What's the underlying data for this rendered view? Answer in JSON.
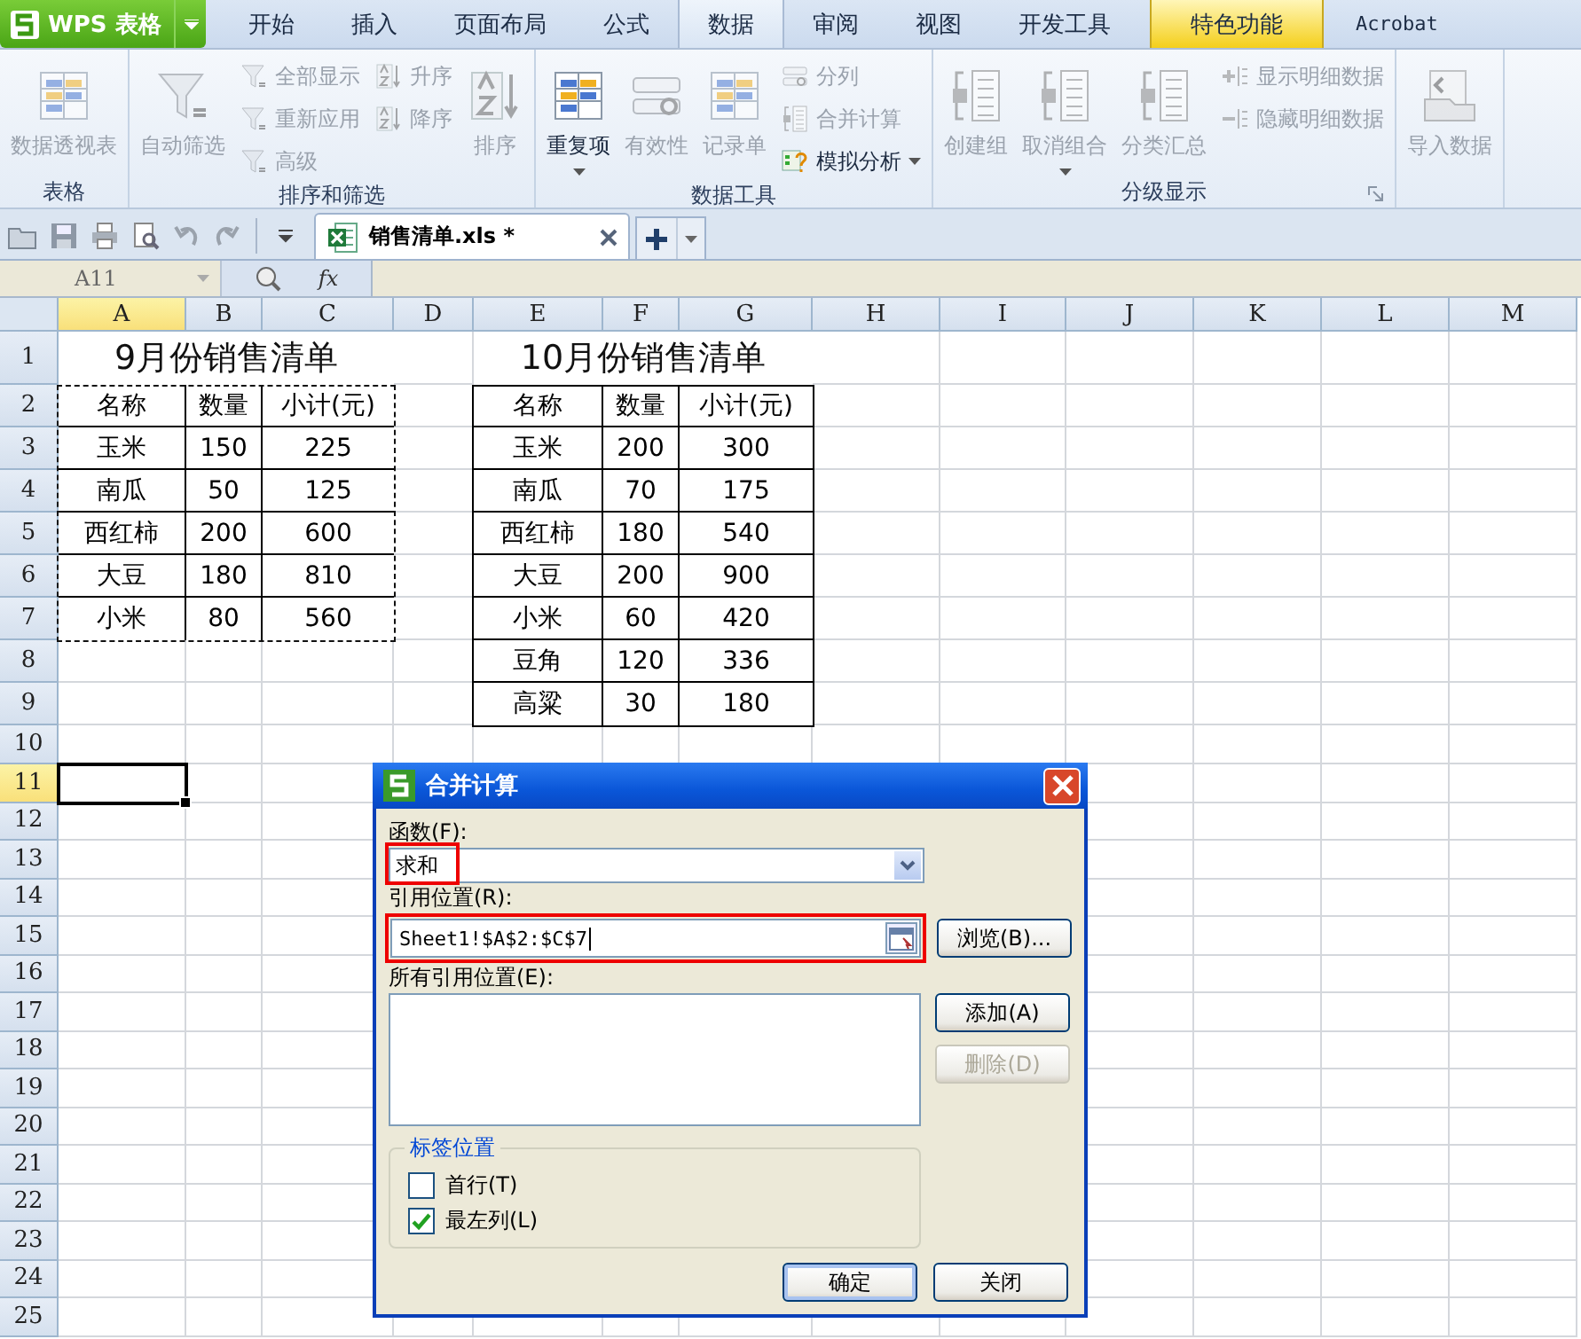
{
  "app_button": {
    "label": "WPS 表格"
  },
  "ribbon_tabs": [
    {
      "label": "开始",
      "selected": false,
      "kind": "normal"
    },
    {
      "label": "插入",
      "selected": false,
      "kind": "normal"
    },
    {
      "label": "页面布局",
      "selected": false,
      "kind": "normal"
    },
    {
      "label": "公式",
      "selected": false,
      "kind": "normal"
    },
    {
      "label": "数据",
      "selected": true,
      "kind": "normal"
    },
    {
      "label": "审阅",
      "selected": false,
      "kind": "normal"
    },
    {
      "label": "视图",
      "selected": false,
      "kind": "normal"
    },
    {
      "label": "开发工具",
      "selected": false,
      "kind": "normal"
    },
    {
      "label": "特色功能",
      "selected": false,
      "kind": "special"
    },
    {
      "label": "Acrobat",
      "selected": false,
      "kind": "addin"
    }
  ],
  "ribbon_groups": [
    {
      "label": "表格",
      "items": [
        {
          "kind": "large",
          "label": "数据透视表",
          "disabled": true
        }
      ]
    },
    {
      "label": "排序和筛选",
      "items": [
        {
          "kind": "large",
          "label": "自动筛选",
          "disabled": true
        },
        {
          "kind": "small",
          "label": "全部显示",
          "disabled": true
        },
        {
          "kind": "small",
          "label": "重新应用",
          "disabled": true
        },
        {
          "kind": "small",
          "label": "高级",
          "disabled": true
        },
        {
          "kind": "small",
          "label": "升序",
          "disabled": true
        },
        {
          "kind": "small",
          "label": "降序",
          "disabled": true
        },
        {
          "kind": "large",
          "label": "排序",
          "disabled": true
        }
      ]
    },
    {
      "label": "数据工具",
      "items": [
        {
          "kind": "large",
          "label": "重复项",
          "disabled": false,
          "dropdown": true
        },
        {
          "kind": "large",
          "label": "有效性",
          "disabled": true
        },
        {
          "kind": "large",
          "label": "记录单",
          "disabled": true
        },
        {
          "kind": "small",
          "label": "分列",
          "disabled": true
        },
        {
          "kind": "small",
          "label": "合并计算",
          "disabled": true
        },
        {
          "kind": "small",
          "label": "模拟分析",
          "disabled": false,
          "dropdown": true
        }
      ]
    },
    {
      "label": "分级显示",
      "launcher": true,
      "items": [
        {
          "kind": "large",
          "label": "创建组",
          "disabled": true
        },
        {
          "kind": "large",
          "label": "取消组合",
          "disabled": true,
          "dropdown": true
        },
        {
          "kind": "large",
          "label": "分类汇总",
          "disabled": true
        },
        {
          "kind": "small",
          "label": "显示明细数据",
          "disabled": true
        },
        {
          "kind": "small",
          "label": "隐藏明细数据",
          "disabled": true
        }
      ]
    },
    {
      "items": [
        {
          "kind": "large",
          "label": "导入数据",
          "disabled": true
        }
      ]
    }
  ],
  "document_tab": {
    "title": "销售清单.xls *"
  },
  "formula_bar": {
    "name_box": "A11",
    "fx": "fx"
  },
  "sheet": {
    "columns": [
      {
        "label": "A",
        "selected": true
      },
      {
        "label": "B",
        "selected": false
      },
      {
        "label": "C",
        "selected": false
      },
      {
        "label": "D",
        "selected": false
      },
      {
        "label": "E",
        "selected": false
      },
      {
        "label": "F",
        "selected": false
      },
      {
        "label": "G",
        "selected": false
      },
      {
        "label": "H",
        "selected": false
      },
      {
        "label": "I",
        "selected": false
      },
      {
        "label": "J",
        "selected": false
      },
      {
        "label": "K",
        "selected": false
      },
      {
        "label": "L",
        "selected": false
      },
      {
        "label": "M",
        "selected": false
      }
    ],
    "rows": [
      {
        "label": "1",
        "selected": false
      },
      {
        "label": "2",
        "selected": false
      },
      {
        "label": "3",
        "selected": false
      },
      {
        "label": "4",
        "selected": false
      },
      {
        "label": "5",
        "selected": false
      },
      {
        "label": "6",
        "selected": false
      },
      {
        "label": "7",
        "selected": false
      },
      {
        "label": "8",
        "selected": false
      },
      {
        "label": "9",
        "selected": false
      },
      {
        "label": "10",
        "selected": false
      },
      {
        "label": "11",
        "selected": true
      },
      {
        "label": "12",
        "selected": false
      },
      {
        "label": "13",
        "selected": false
      },
      {
        "label": "14",
        "selected": false
      },
      {
        "label": "15",
        "selected": false
      },
      {
        "label": "16",
        "selected": false
      },
      {
        "label": "17",
        "selected": false
      },
      {
        "label": "18",
        "selected": false
      },
      {
        "label": "19",
        "selected": false
      },
      {
        "label": "20",
        "selected": false
      },
      {
        "label": "21",
        "selected": false
      },
      {
        "label": "22",
        "selected": false
      },
      {
        "label": "23",
        "selected": false
      },
      {
        "label": "24",
        "selected": false
      },
      {
        "label": "25",
        "selected": false
      }
    ],
    "tables": [
      {
        "title": "9月份销售清单",
        "copy_marquee": true,
        "header": [
          "名称",
          "数量",
          "小计(元)"
        ],
        "rows": [
          [
            "玉米",
            "150",
            "225"
          ],
          [
            "南瓜",
            "50",
            "125"
          ],
          [
            "西红柿",
            "200",
            "600"
          ],
          [
            "大豆",
            "180",
            "810"
          ],
          [
            "小米",
            "80",
            "560"
          ]
        ]
      },
      {
        "title": "10月份销售清单",
        "copy_marquee": false,
        "header": [
          "名称",
          "数量",
          "小计(元)"
        ],
        "rows": [
          [
            "玉米",
            "200",
            "300"
          ],
          [
            "南瓜",
            "70",
            "175"
          ],
          [
            "西红柿",
            "180",
            "540"
          ],
          [
            "大豆",
            "200",
            "900"
          ],
          [
            "小米",
            "60",
            "420"
          ],
          [
            "豆角",
            "120",
            "336"
          ],
          [
            "高粱",
            "30",
            "180"
          ]
        ]
      }
    ]
  },
  "dialog": {
    "title": "合并计算",
    "function": {
      "label": "函数(F):",
      "value": "求和",
      "highlighted": true
    },
    "reference": {
      "label": "引用位置(R):",
      "value": "Sheet1!$A$2:$C$7",
      "highlighted": true
    },
    "browse_button": "浏览(B)...",
    "all_references": {
      "label": "所有引用位置(E):"
    },
    "side_buttons": [
      {
        "label": "添加(A)",
        "disabled": false
      },
      {
        "label": "删除(D)",
        "disabled": true
      }
    ],
    "label_group": {
      "title": "标签位置",
      "options": [
        {
          "label": "首行(T)",
          "checked": false
        },
        {
          "label": "最左列(L)",
          "checked": true
        }
      ]
    },
    "buttons": [
      {
        "label": "确定",
        "default": true
      },
      {
        "label": "关闭",
        "default": false
      }
    ]
  }
}
